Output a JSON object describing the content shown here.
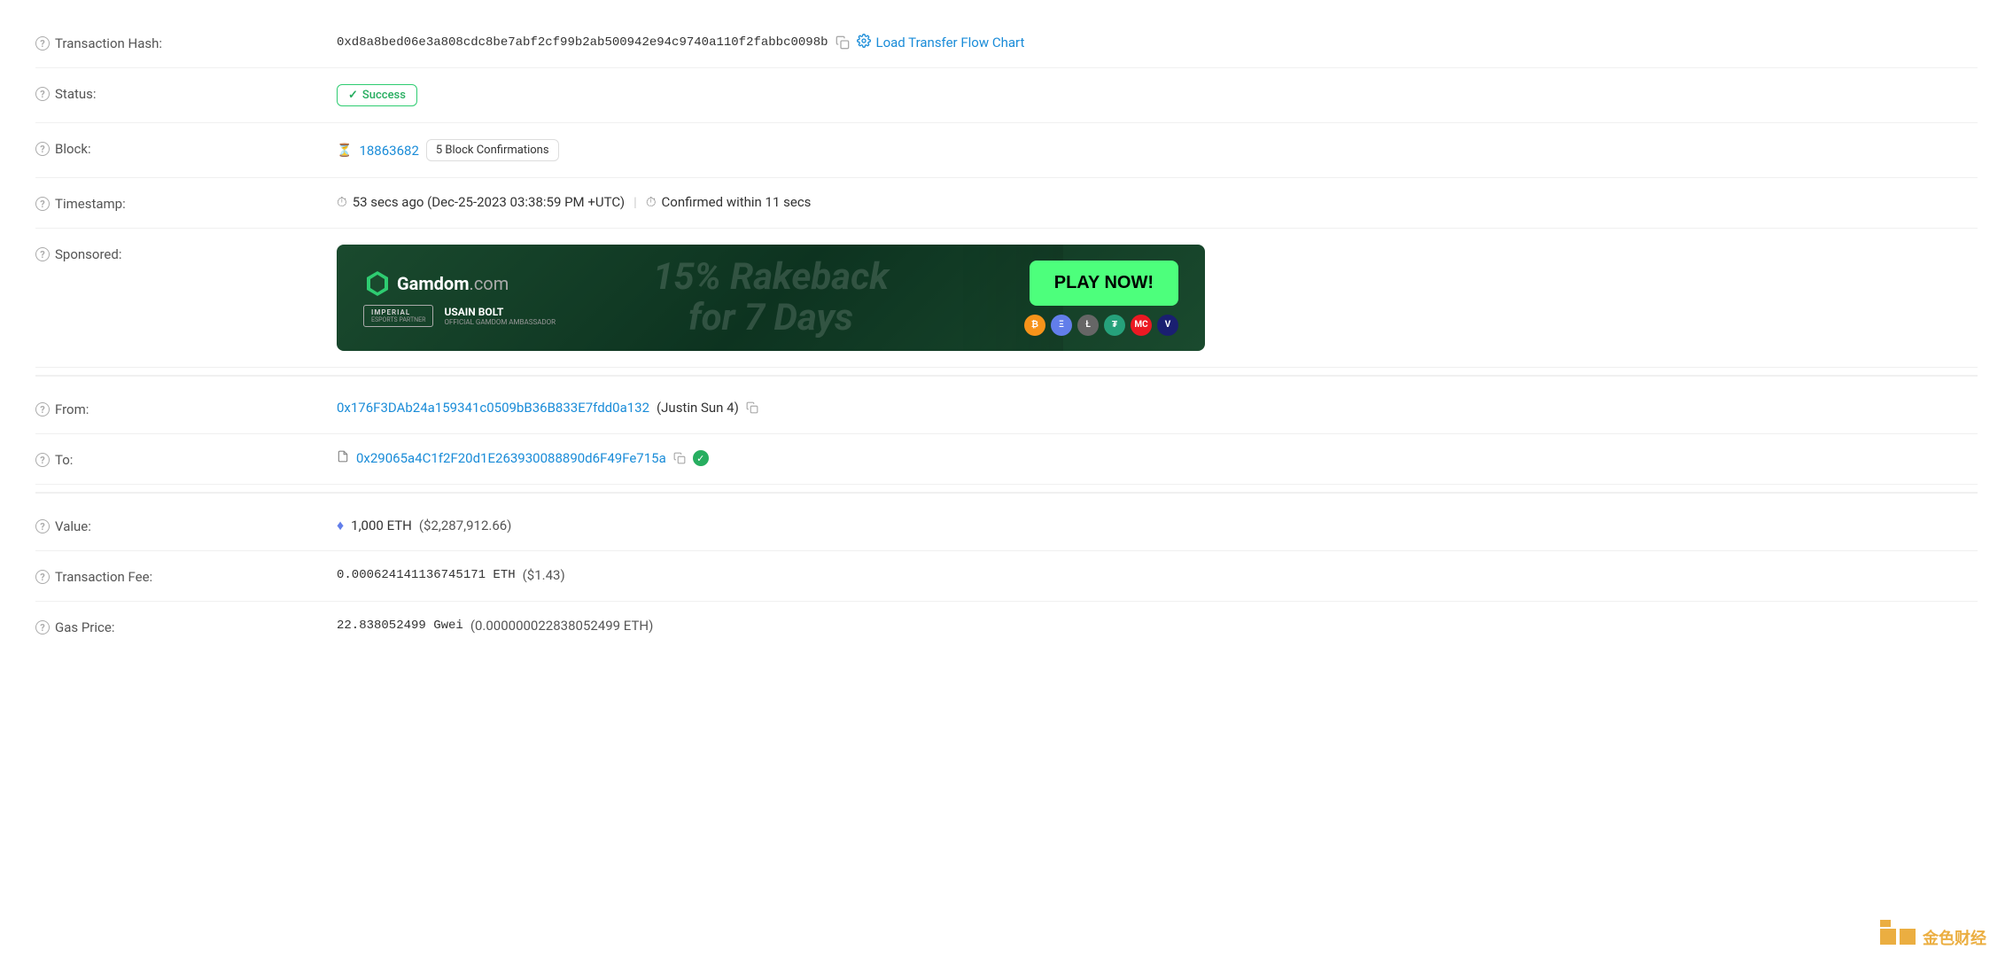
{
  "transaction": {
    "hash_label": "Transaction Hash:",
    "hash_value": "0xd8a8bed06e3a808cdc8be7abf2cf99b2ab500942e94c9740a110f2fabbc0098b",
    "load_chart_label": "Load Transfer Flow Chart",
    "status_label": "Status:",
    "status_value": "Success",
    "block_label": "Block:",
    "block_number": "18863682",
    "confirmations": "5 Block Confirmations",
    "timestamp_label": "Timestamp:",
    "timestamp_ago": "53 secs ago (Dec-25-2023 03:38:59 PM +UTC)",
    "confirmed_within": "Confirmed within 11 secs",
    "sponsored_label": "Sponsored:",
    "from_label": "From:",
    "from_address": "0x176F3DAb24a159341c0509bB36B833E7fdd0a132",
    "from_name": "(Justin Sun 4)",
    "to_label": "To:",
    "to_address": "0x29065a4C1f2F20d1E263930088890d6F49Fe715a",
    "value_label": "Value:",
    "value_eth": "1,000 ETH",
    "value_usd": "($2,287,912.66)",
    "fee_label": "Transaction Fee:",
    "fee_value": "0.000624141136745171 ETH",
    "fee_usd": "($1.43)",
    "gas_label": "Gas Price:",
    "gas_gwei": "22.838052499 Gwei",
    "gas_eth": "(0.000000022838052499 ETH)"
  },
  "banner": {
    "brand": "Gamdom",
    "domain": ".com",
    "rakeback_line1": "15% Rakeback",
    "rakeback_line2": "for 7 Days",
    "play_now": "PLAY NOW!",
    "imperial_label": "IMPERIAL",
    "imperial_sub": "ESPORTS PARTNER",
    "usain_bolt_label": "USAIN BOLT",
    "usain_bolt_sub": "OFFICIAL GAMDOM AMBASSADOR"
  },
  "icons": {
    "help": "?",
    "copy": "⧉",
    "success_check": "✓",
    "clock": "⏱",
    "hourglass": "⏳",
    "contract": "📄",
    "verified": "✓",
    "eth_diamond": "♦",
    "gear": "⚙"
  }
}
